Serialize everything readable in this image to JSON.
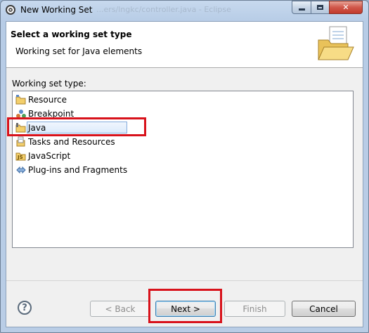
{
  "window": {
    "title": "New Working Set",
    "ghost_text": "...ers/lngkc/controller.java - Eclipse",
    "minimize_icon": "minimize-icon",
    "maximize_icon": "maximize-icon",
    "close_icon": "close-icon",
    "close_glyph": "✕"
  },
  "banner": {
    "title": "Select a working set type",
    "description": "Working set for Java elements",
    "icon": "folder-document-icon"
  },
  "list": {
    "label": "Working set type:",
    "items": [
      {
        "label": "Resource",
        "icon": "resource-folder-icon"
      },
      {
        "label": "Breakpoint",
        "icon": "breakpoint-icon"
      },
      {
        "label": "Java",
        "icon": "java-folder-icon",
        "selected": true
      },
      {
        "label": "Tasks and Resources",
        "icon": "tasks-icon"
      },
      {
        "label": "JavaScript",
        "icon": "javascript-icon"
      },
      {
        "label": "Plug-ins and Fragments",
        "icon": "plugin-icon"
      }
    ]
  },
  "buttons": {
    "help": "?",
    "back": "< Back",
    "next": "Next >",
    "finish": "Finish",
    "cancel": "Cancel"
  },
  "colors": {
    "highlight": "#d8121b",
    "selection_border": "#84acdd"
  }
}
